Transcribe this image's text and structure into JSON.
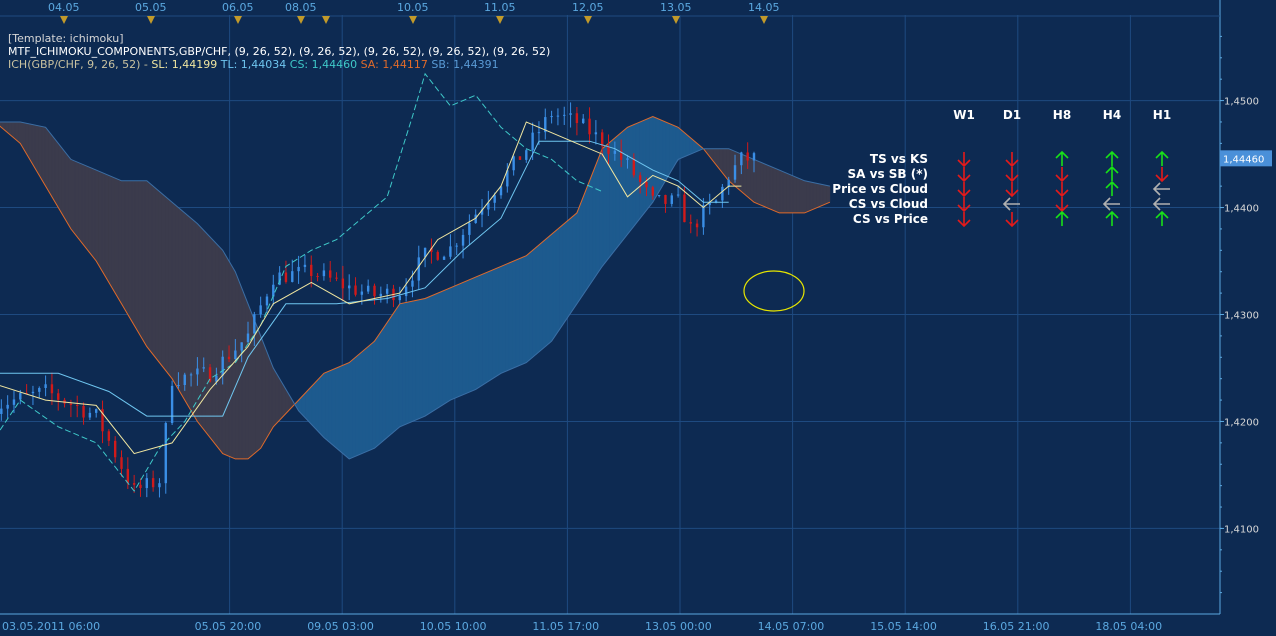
{
  "header": {
    "template_label": "[Template: ichimoku]",
    "indicator_line": "MTF_ICHIMOKU_COMPONENTS,GBP/CHF, (9, 26, 52), (9, 26, 52), (9, 26, 52), (9, 26, 52), (9, 26, 52)",
    "ich_prefix": "ICH(GBP/CHF, 9, 26, 52) -",
    "sl": "SL: 1,44199",
    "tl": "TL: 1,44034",
    "cs": "CS: 1,44460",
    "sa": "SA: 1,44117",
    "sb": "SB: 1,44391"
  },
  "colors": {
    "background": "#0d2a52",
    "grid": "#1e4a80",
    "axis_text": "#5ba8e0",
    "bull": "#3a8ee6",
    "bear": "#d11a1a",
    "tenkan": "#f0e6a0",
    "kijun": "#6fc6f0",
    "chikou": "#3fc9c9",
    "span_a": "#e06a2a",
    "cloud_bull": "#1d5a8e",
    "cloud_bear": "#3b3b4c",
    "arrow_up": "#18e018",
    "arrow_down": "#e41a1a",
    "arrow_flat": "#b0b0b0",
    "marker": "#c29a2a",
    "ellipse": "#e6e600"
  },
  "chart_data": {
    "type": "candlestick",
    "symbol": "GBP/CHF",
    "ylim": [
      1.402,
      1.458
    ],
    "y_ticks": [
      "1,4500",
      "1,4400",
      "1,4300",
      "1,4200",
      "1,4100"
    ],
    "current_price_label": "1,44460",
    "current_price": 1.4446,
    "x_ticks": [
      "03.05.2011 06:00",
      "05.05 20:00",
      "09.05 03:00",
      "10.05 10:00",
      "11.05 17:00",
      "13.05 00:00",
      "14.05 07:00",
      "15.05 14:00",
      "16.05 21:00",
      "18.05 04:00"
    ],
    "day_labels": [
      "04.05",
      "05.05",
      "06.05",
      "08.05",
      "10.05",
      "11.05",
      "12.05",
      "13.05",
      "14.05"
    ],
    "day_label_positions": [
      2,
      10,
      18,
      24,
      34,
      41,
      48,
      55,
      62
    ],
    "marker_positions": [
      2,
      10,
      18,
      24,
      26,
      34,
      41,
      48,
      55,
      62
    ],
    "price_path": {
      "x": [
        0,
        4,
        8,
        11,
        13,
        14,
        17,
        20,
        22,
        25,
        28,
        30,
        32,
        34,
        36,
        38,
        40,
        42,
        44,
        46,
        48,
        50,
        52,
        54,
        55,
        56,
        57,
        58,
        59,
        60
      ],
      "y": [
        1.4215,
        1.4228,
        1.4205,
        1.4135,
        1.4145,
        1.424,
        1.4245,
        1.428,
        1.4335,
        1.434,
        1.4325,
        1.4318,
        1.4322,
        1.4355,
        1.4362,
        1.4395,
        1.4425,
        1.4455,
        1.4488,
        1.448,
        1.4462,
        1.444,
        1.4405,
        1.4405,
        1.438,
        1.4395,
        1.4405,
        1.443,
        1.4445,
        1.4446
      ]
    },
    "lines": {
      "tenkan_sen": {
        "x": [
          0,
          4,
          8,
          11,
          14,
          17,
          20,
          22,
          25,
          28,
          32,
          35,
          38,
          40,
          42,
          44,
          46,
          48,
          50,
          52,
          54,
          56,
          58,
          59
        ],
        "y": [
          1.4235,
          1.422,
          1.4215,
          1.417,
          1.418,
          1.423,
          1.427,
          1.431,
          1.433,
          1.431,
          1.432,
          1.437,
          1.439,
          1.442,
          1.448,
          1.447,
          1.446,
          1.445,
          1.441,
          1.443,
          1.442,
          1.44,
          1.442,
          1.442
        ]
      },
      "kijun_sen": {
        "x": [
          0,
          5,
          9,
          12,
          15,
          18,
          20,
          23,
          27,
          31,
          34,
          37,
          40,
          43,
          47,
          49,
          52,
          54,
          56,
          58
        ],
        "y": [
          1.4245,
          1.4245,
          1.4228,
          1.4205,
          1.4205,
          1.4205,
          1.426,
          1.431,
          1.431,
          1.4315,
          1.4325,
          1.436,
          1.439,
          1.4462,
          1.4462,
          1.4455,
          1.4435,
          1.4425,
          1.4405,
          1.4405
        ]
      },
      "chikou_span": {
        "x": [
          0,
          2,
          5,
          8,
          11,
          13,
          15,
          17,
          19,
          21,
          23,
          25,
          27,
          29,
          31,
          33,
          34,
          36,
          38,
          40,
          42,
          44,
          46,
          48
        ],
        "y": [
          1.4185,
          1.422,
          1.4195,
          1.418,
          1.4135,
          1.4175,
          1.42,
          1.424,
          1.4255,
          1.429,
          1.4345,
          1.436,
          1.437,
          1.439,
          1.441,
          1.4485,
          1.4525,
          1.4495,
          1.4505,
          1.4475,
          1.4455,
          1.4445,
          1.4425,
          1.4415
        ]
      }
    },
    "cloud": {
      "x": [
        0,
        2,
        4,
        6,
        8,
        10,
        12,
        14,
        16,
        18,
        19,
        20,
        21,
        22,
        24,
        26,
        28,
        30,
        32,
        34,
        36,
        38,
        40,
        42,
        44,
        46,
        48,
        50,
        52,
        54,
        56,
        58,
        60,
        62,
        64,
        66
      ],
      "span_a": [
        1.448,
        1.446,
        1.442,
        1.438,
        1.435,
        1.431,
        1.427,
        1.424,
        1.42,
        1.417,
        1.4165,
        1.4165,
        1.4175,
        1.4195,
        1.422,
        1.4245,
        1.4255,
        1.4275,
        1.431,
        1.4315,
        1.4325,
        1.4335,
        1.4345,
        1.4355,
        1.4375,
        1.4395,
        1.4455,
        1.4475,
        1.4485,
        1.4475,
        1.4455,
        1.4425,
        1.4405,
        1.4395,
        1.4395,
        1.4405
      ],
      "span_b": [
        1.448,
        1.448,
        1.4475,
        1.4445,
        1.4435,
        1.4425,
        1.4425,
        1.4405,
        1.4385,
        1.436,
        1.434,
        1.431,
        1.428,
        1.425,
        1.421,
        1.4185,
        1.4165,
        1.4175,
        1.4195,
        1.4205,
        1.422,
        1.423,
        1.4245,
        1.4255,
        1.4275,
        1.431,
        1.4345,
        1.4375,
        1.4405,
        1.4445,
        1.4455,
        1.4455,
        1.4445,
        1.4435,
        1.4425,
        1.442
      ]
    },
    "table": {
      "columns": [
        "W1",
        "D1",
        "H8",
        "H4",
        "H1"
      ],
      "rows": [
        {
          "label": "TS vs KS",
          "signals": [
            "down",
            "down",
            "up",
            "up",
            "up"
          ]
        },
        {
          "label": "SA vs SB (*)",
          "signals": [
            "down",
            "down",
            "down",
            "up",
            "down"
          ]
        },
        {
          "label": "Price vs Cloud",
          "signals": [
            "down",
            "down",
            "down",
            "up",
            "flat"
          ]
        },
        {
          "label": "CS vs Cloud",
          "signals": [
            "down",
            "flat",
            "down",
            "flat",
            "flat"
          ]
        },
        {
          "label": "CS vs Price",
          "signals": [
            "down",
            "down",
            "up",
            "up",
            "up"
          ]
        }
      ]
    }
  }
}
